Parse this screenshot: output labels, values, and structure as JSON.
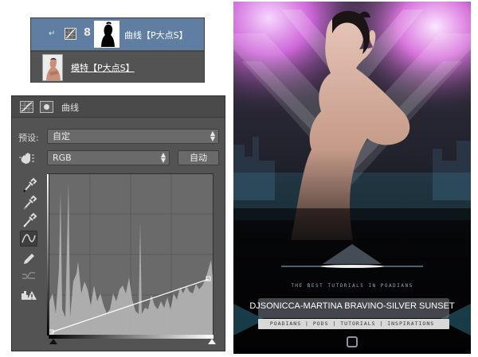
{
  "layers": {
    "curves_layer": {
      "name": "曲线【P大点S】",
      "link_glyph": "8",
      "clip_glyph": "↵"
    },
    "model_layer": {
      "name": "模特【P大点S】"
    }
  },
  "properties": {
    "header_title": "曲线",
    "preset_label": "预设:",
    "preset_value": "自定",
    "channel_value": "RGB",
    "auto_label": "自动"
  },
  "poster": {
    "tagline": "THE BEST TUTORIALS IN POADIANS",
    "title": "DJSONICCA-MARTINA BRAVINO-SILVER SUNSET",
    "subtitle": "POADIANS | PODS | TUTORIALS | INSPIRATIONS"
  },
  "colors": {
    "panel_bg": "#535353",
    "selected_layer": "#5f7ea2",
    "poster_glow": "#d070d8"
  },
  "icons": [
    "clip-arrow-icon",
    "curves-adjustment-icon",
    "link-icon",
    "mask-icon",
    "hand-target-icon",
    "eyedropper-icon",
    "curve-point-icon",
    "pencil-icon",
    "smooth-icon",
    "clipping-warning-icon"
  ]
}
